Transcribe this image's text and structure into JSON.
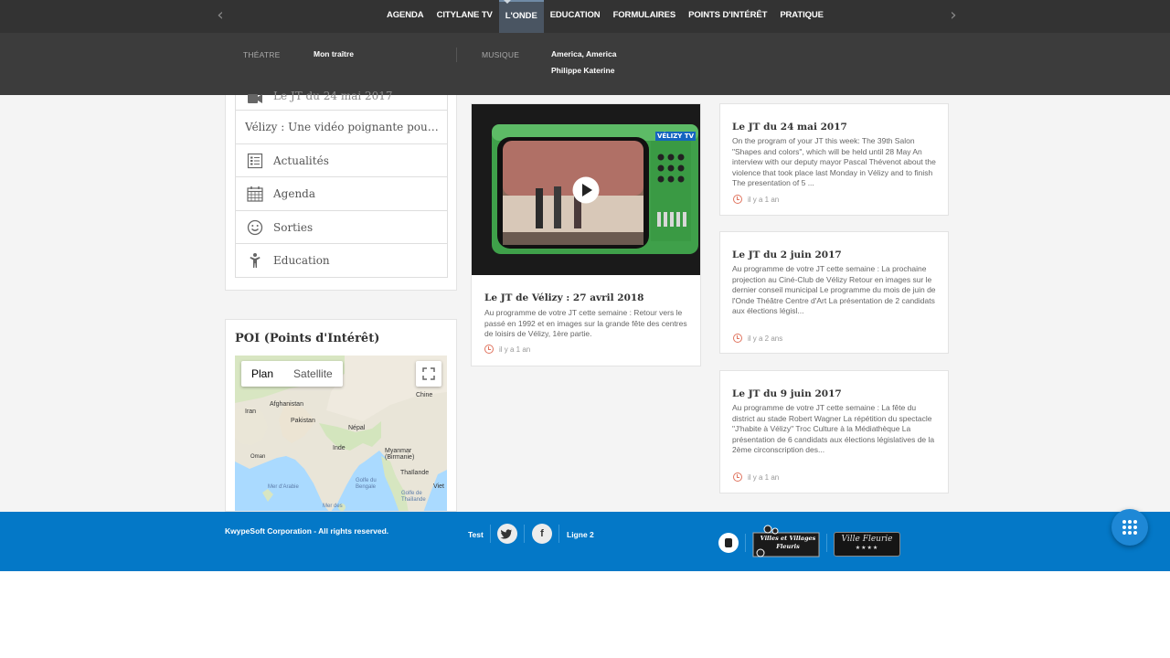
{
  "nav": {
    "items": [
      {
        "label": "AGENDA"
      },
      {
        "label": "CITYLANE TV"
      },
      {
        "label": "L'ONDE",
        "active": true
      },
      {
        "label": "EDUCATION"
      },
      {
        "label": "FORMULAIRES"
      },
      {
        "label": "POINTS D'INTÉRÊT"
      },
      {
        "label": "PRATIQUE"
      }
    ],
    "prev_icon": "chevron-left-icon",
    "next_icon": "chevron-right-icon"
  },
  "submenu": {
    "theatre_label": "THÉATRE",
    "theatre_item": "Mon traître",
    "musique_label": "MUSIQUE",
    "musique_items": [
      "America, America",
      "Philippe Katerine"
    ]
  },
  "sidebar": {
    "items": [
      {
        "label": "Le JT du 24 mai 2017",
        "icon": "video-camera-icon"
      },
      {
        "label": "Vélizy : Une vidéo poignante pour ...",
        "icon": ""
      },
      {
        "label": "Actualités",
        "icon": "newspaper-icon"
      },
      {
        "label": "Agenda",
        "icon": "calendar-icon"
      },
      {
        "label": "Sorties",
        "icon": "smiley-icon"
      },
      {
        "label": "Education",
        "icon": "child-icon"
      }
    ]
  },
  "poi": {
    "title": "POI (Points d'Intérêt)",
    "map": {
      "tab_plan": "Plan",
      "tab_satellite": "Satellite",
      "labels": [
        "Afghanistan",
        "Iran",
        "Pakistan",
        "Népal",
        "Chine",
        "Inde",
        "Oman",
        "Myanmar (Birmanie)",
        "Thaïlande",
        "Mer d'Arabie",
        "Golfe du Bengale",
        "Golfe de Thaïlande",
        "Viet",
        "Mer des"
      ]
    }
  },
  "video": {
    "overlay_text": "VÉLIZY TV",
    "title": "Le JT de Vélizy : 27 avril 2018",
    "text": "Au programme de votre JT cette semaine : Retour vers le passé en 1992 et en images sur la grande fête des centres de loisirs de Vélizy, 1ère partie.",
    "time": "il y a 1 an"
  },
  "news": [
    {
      "title": "Le JT du 24 mai 2017",
      "text": "On the program of your JT this week: The 39th Salon \"Shapes and colors\", which will be held until 28 May An interview with our deputy mayor Pascal Thévenot about the violence that took place last Monday in Vélizy and to finish The presentation of 5 ...",
      "time": "il y a 1 an"
    },
    {
      "title": "Le JT du 2 juin 2017",
      "text": "Au programme de votre JT cette semaine : La prochaine projection au Ciné-Club de Vélizy Retour en images sur le dernier conseil municipal Le programme du mois de juin de l'Onde Théâtre Centre d'Art La présentation de 2 candidats aux élections législ...",
      "time": "il y a 2 ans"
    },
    {
      "title": "Le JT du 9 juin 2017",
      "text": "Au programme de votre JT cette semaine : La fête du district au stade Robert Wagner La répétition du spectacle \"J'habite à Vélizy\" Troc Culture à la Médiathèque La présentation de 6 candidats aux élections législatives de la 2ème circonscription des...",
      "time": "il y a 1 an"
    }
  ],
  "footer": {
    "copyright": "KwypeSoft Corporation - All rights reserved.",
    "link_test": "Test",
    "twitter_glyph": "🐦",
    "facebook_glyph": "f",
    "link_ligne2": "Ligne 2",
    "logo_villes_line1": "Villes et Villages",
    "logo_villes_line2": "Fleuris",
    "logo_fleurie_text": "Ville Fleurie",
    "logo_fleurie_stars": "★★★★",
    "accent_color": "#0478c7"
  },
  "colors": {
    "nav_bg": "#333333",
    "submenu_bg": "#3c3c3c",
    "clock_accent": "#e0745f",
    "tv_green": "#3fa04a"
  }
}
